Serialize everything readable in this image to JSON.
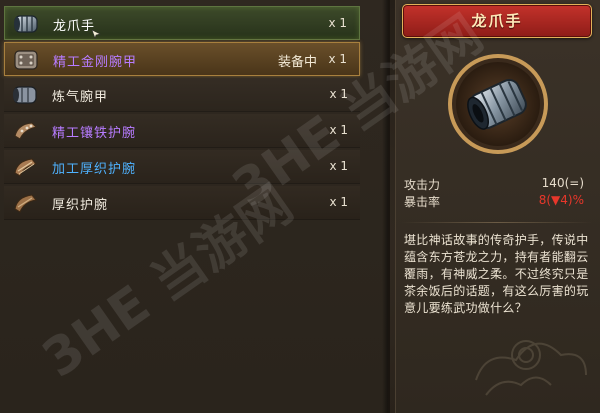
{
  "inventory": {
    "items": [
      {
        "name": "龙爪手",
        "qty": "x 1",
        "color": "#ffffff",
        "icon": "steel-bracer-icon",
        "selected": true
      },
      {
        "name": "精工金刚腕甲",
        "qty": "x 1",
        "color": "#b77cff",
        "status": "装备中",
        "icon": "gold-bracer-icon"
      },
      {
        "name": "炼气腕甲",
        "qty": "x 1",
        "color": "#f2ece0",
        "icon": "dark-bracer-icon"
      },
      {
        "name": "精工镶铁护腕",
        "qty": "x 1",
        "color": "#b77cff",
        "icon": "iron-studded-bracer-icon"
      },
      {
        "name": "加工厚织护腕",
        "qty": "x 1",
        "color": "#4fb2ff",
        "icon": "woven-bracer-icon"
      },
      {
        "name": "厚织护腕",
        "qty": "x 1",
        "color": "#f2ece0",
        "icon": "thick-bracer-icon"
      }
    ]
  },
  "detail": {
    "title": "龙爪手",
    "stats": [
      {
        "label": "攻击力",
        "value": "140(=)",
        "color": "#e6dccb"
      },
      {
        "label": "暴击率",
        "value": "8(▼4)%",
        "color": "#e8372b"
      }
    ],
    "description": "堪比神话故事的传奇护手，传说中蕴含东方苍龙之力，持有者能翻云覆雨，有神威之柔。不过终究只是茶余饭后的话题，有这么厉害的玩意儿要练武功做什么？"
  },
  "watermark": {
    "text": "3HE 当游网"
  }
}
